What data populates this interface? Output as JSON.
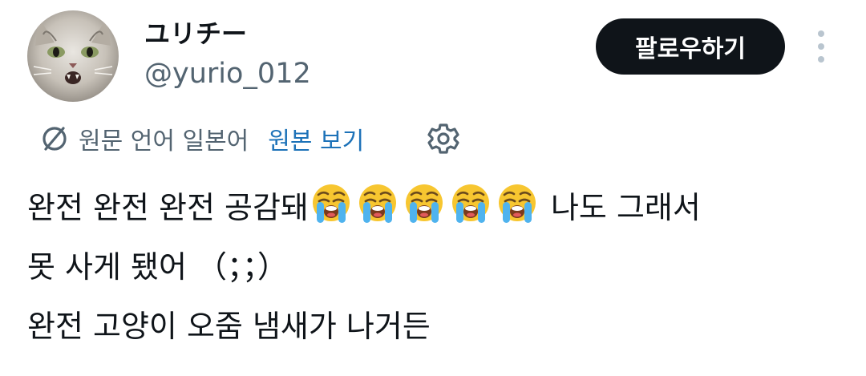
{
  "user": {
    "display_name": "ユリチー",
    "handle": "@yurio_012",
    "avatar_icon": "cat-avatar"
  },
  "actions": {
    "follow_label": "팔로우하기",
    "more_icon": "more-vertical-icon"
  },
  "translation": {
    "info_text": "원문 언어 일본어",
    "link_label": "원본 보기",
    "translate_icon": "translate-slash-icon",
    "settings_icon": "gear-icon"
  },
  "tweet": {
    "line1_text": "완전 완전 완전 공감돼",
    "line1_emoji": "loudly-crying-face",
    "line1_emoji_count": 5,
    "line1_suffix": " 나도 그래서",
    "line2": "못 사게 됐어 （；；）",
    "line3": "완전 고양이 오줌 냄새가 나거든"
  },
  "colors": {
    "text": "#0f1419",
    "secondary": "#536471",
    "link": "#1d72b8",
    "button_bg": "#0f1419"
  }
}
